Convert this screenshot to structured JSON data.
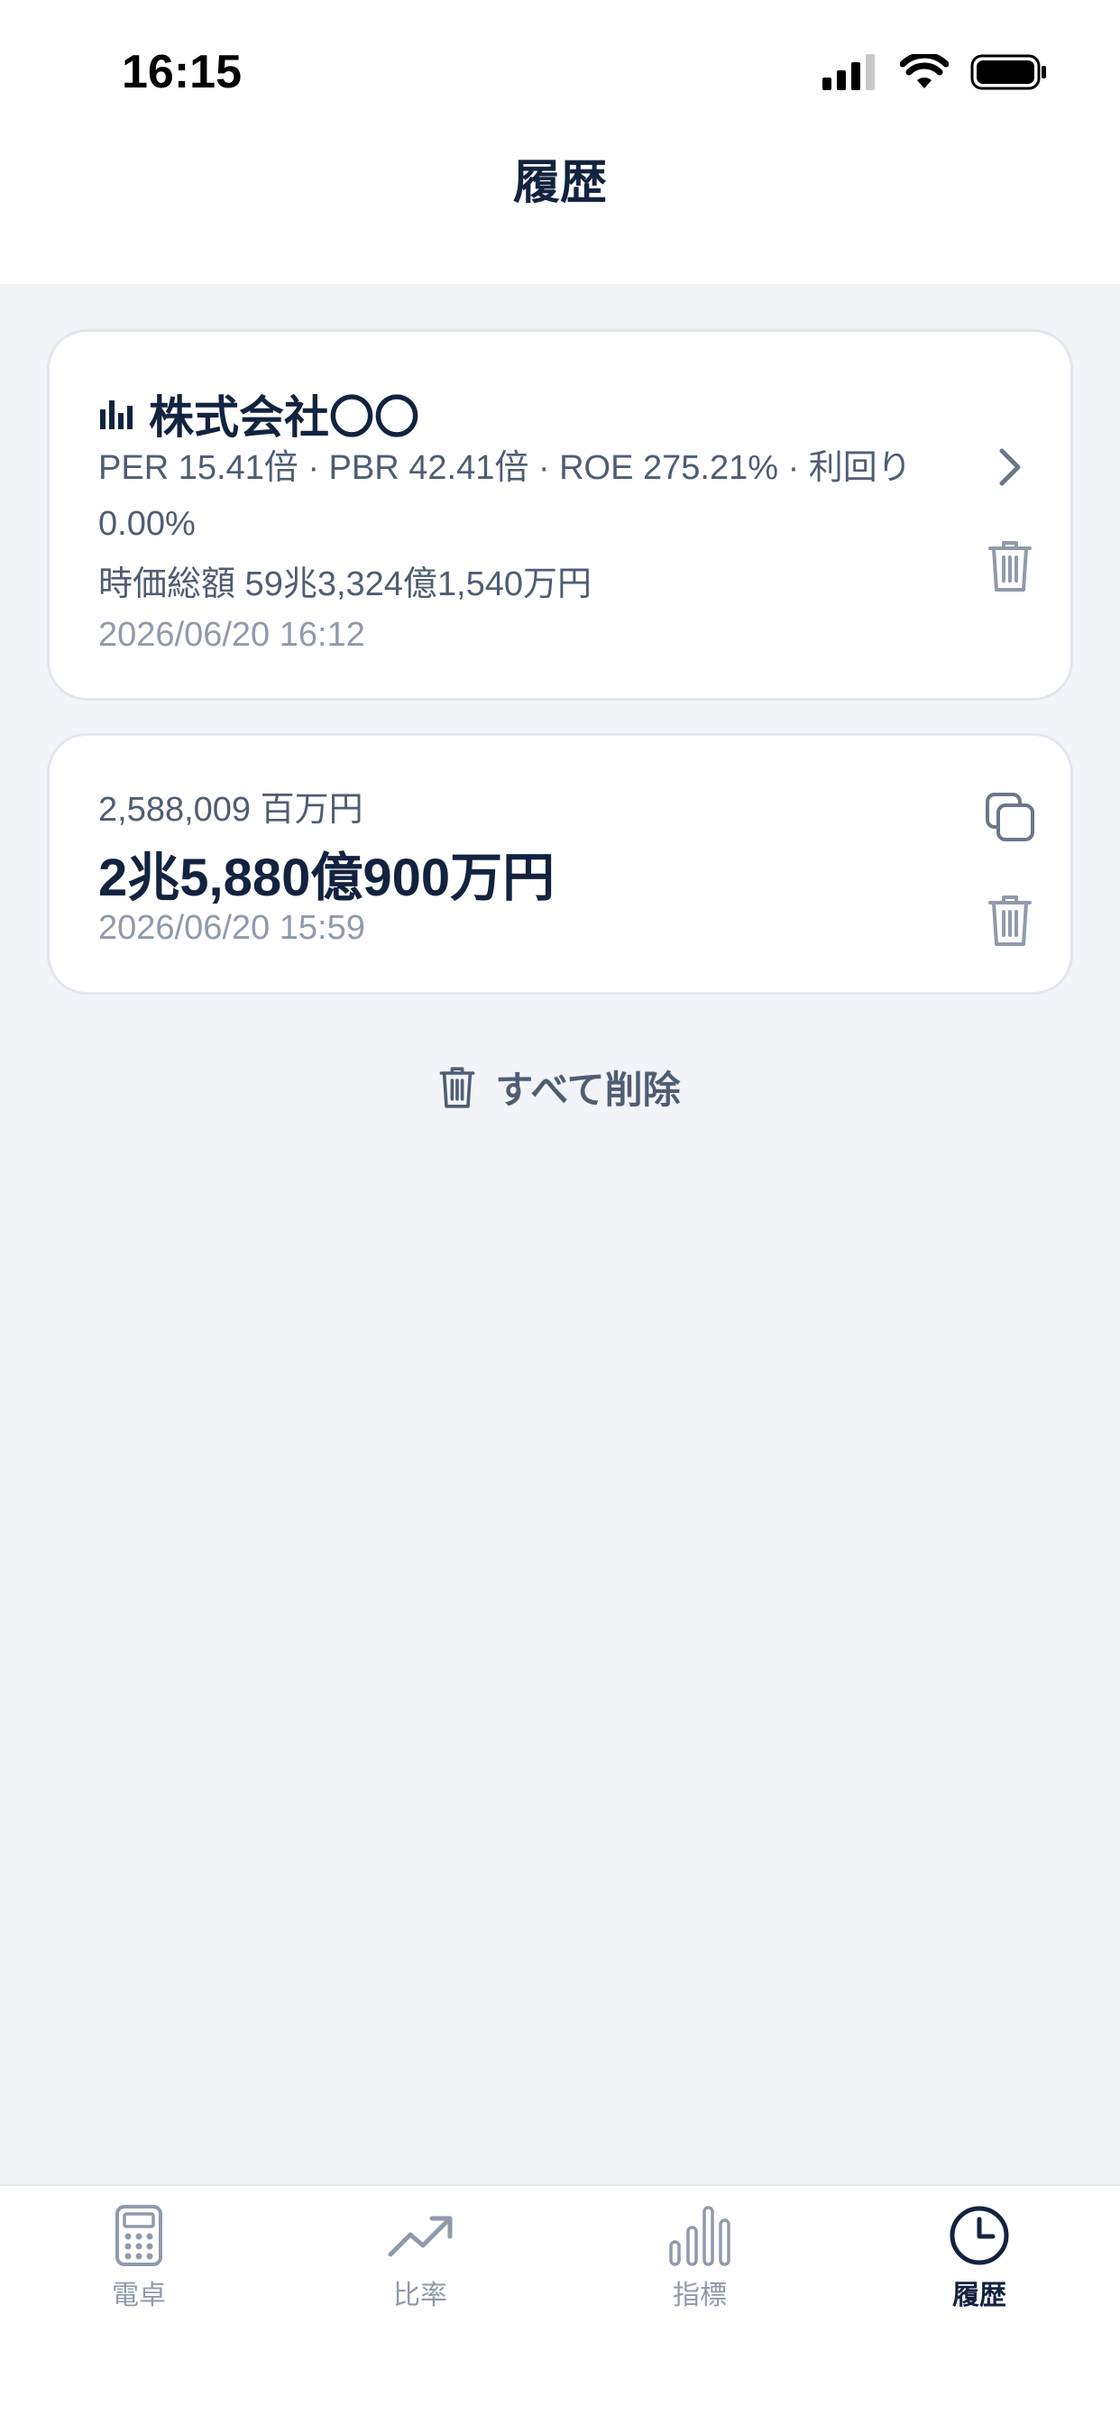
{
  "status_bar": {
    "time": "16:15"
  },
  "header": {
    "title": "履歴"
  },
  "history": [
    {
      "title": "株式会社〇〇",
      "metrics": "PER 15.41倍 · PBR 42.41倍 · ROE 275.21% · 利回り 0.00%",
      "market_cap": "時価総額 59兆3,324億1,540万円",
      "date": "2026/06/20 16:12"
    },
    {
      "subtitle": "2,588,009 百万円",
      "value": "2兆5,880億900万円",
      "date": "2026/06/20 15:59"
    }
  ],
  "actions": {
    "delete_all": "すべて削除"
  },
  "tabs": [
    {
      "label": "電卓",
      "icon": "calculator-icon",
      "active": false
    },
    {
      "label": "比率",
      "icon": "trend-icon",
      "active": false
    },
    {
      "label": "指標",
      "icon": "bar-chart-icon",
      "active": false
    },
    {
      "label": "履歴",
      "icon": "clock-icon",
      "active": true
    }
  ],
  "colors": {
    "primary": "#12233f",
    "secondary": "#4f5d73",
    "muted": "#8f9aab",
    "background": "#f2f4f8"
  }
}
